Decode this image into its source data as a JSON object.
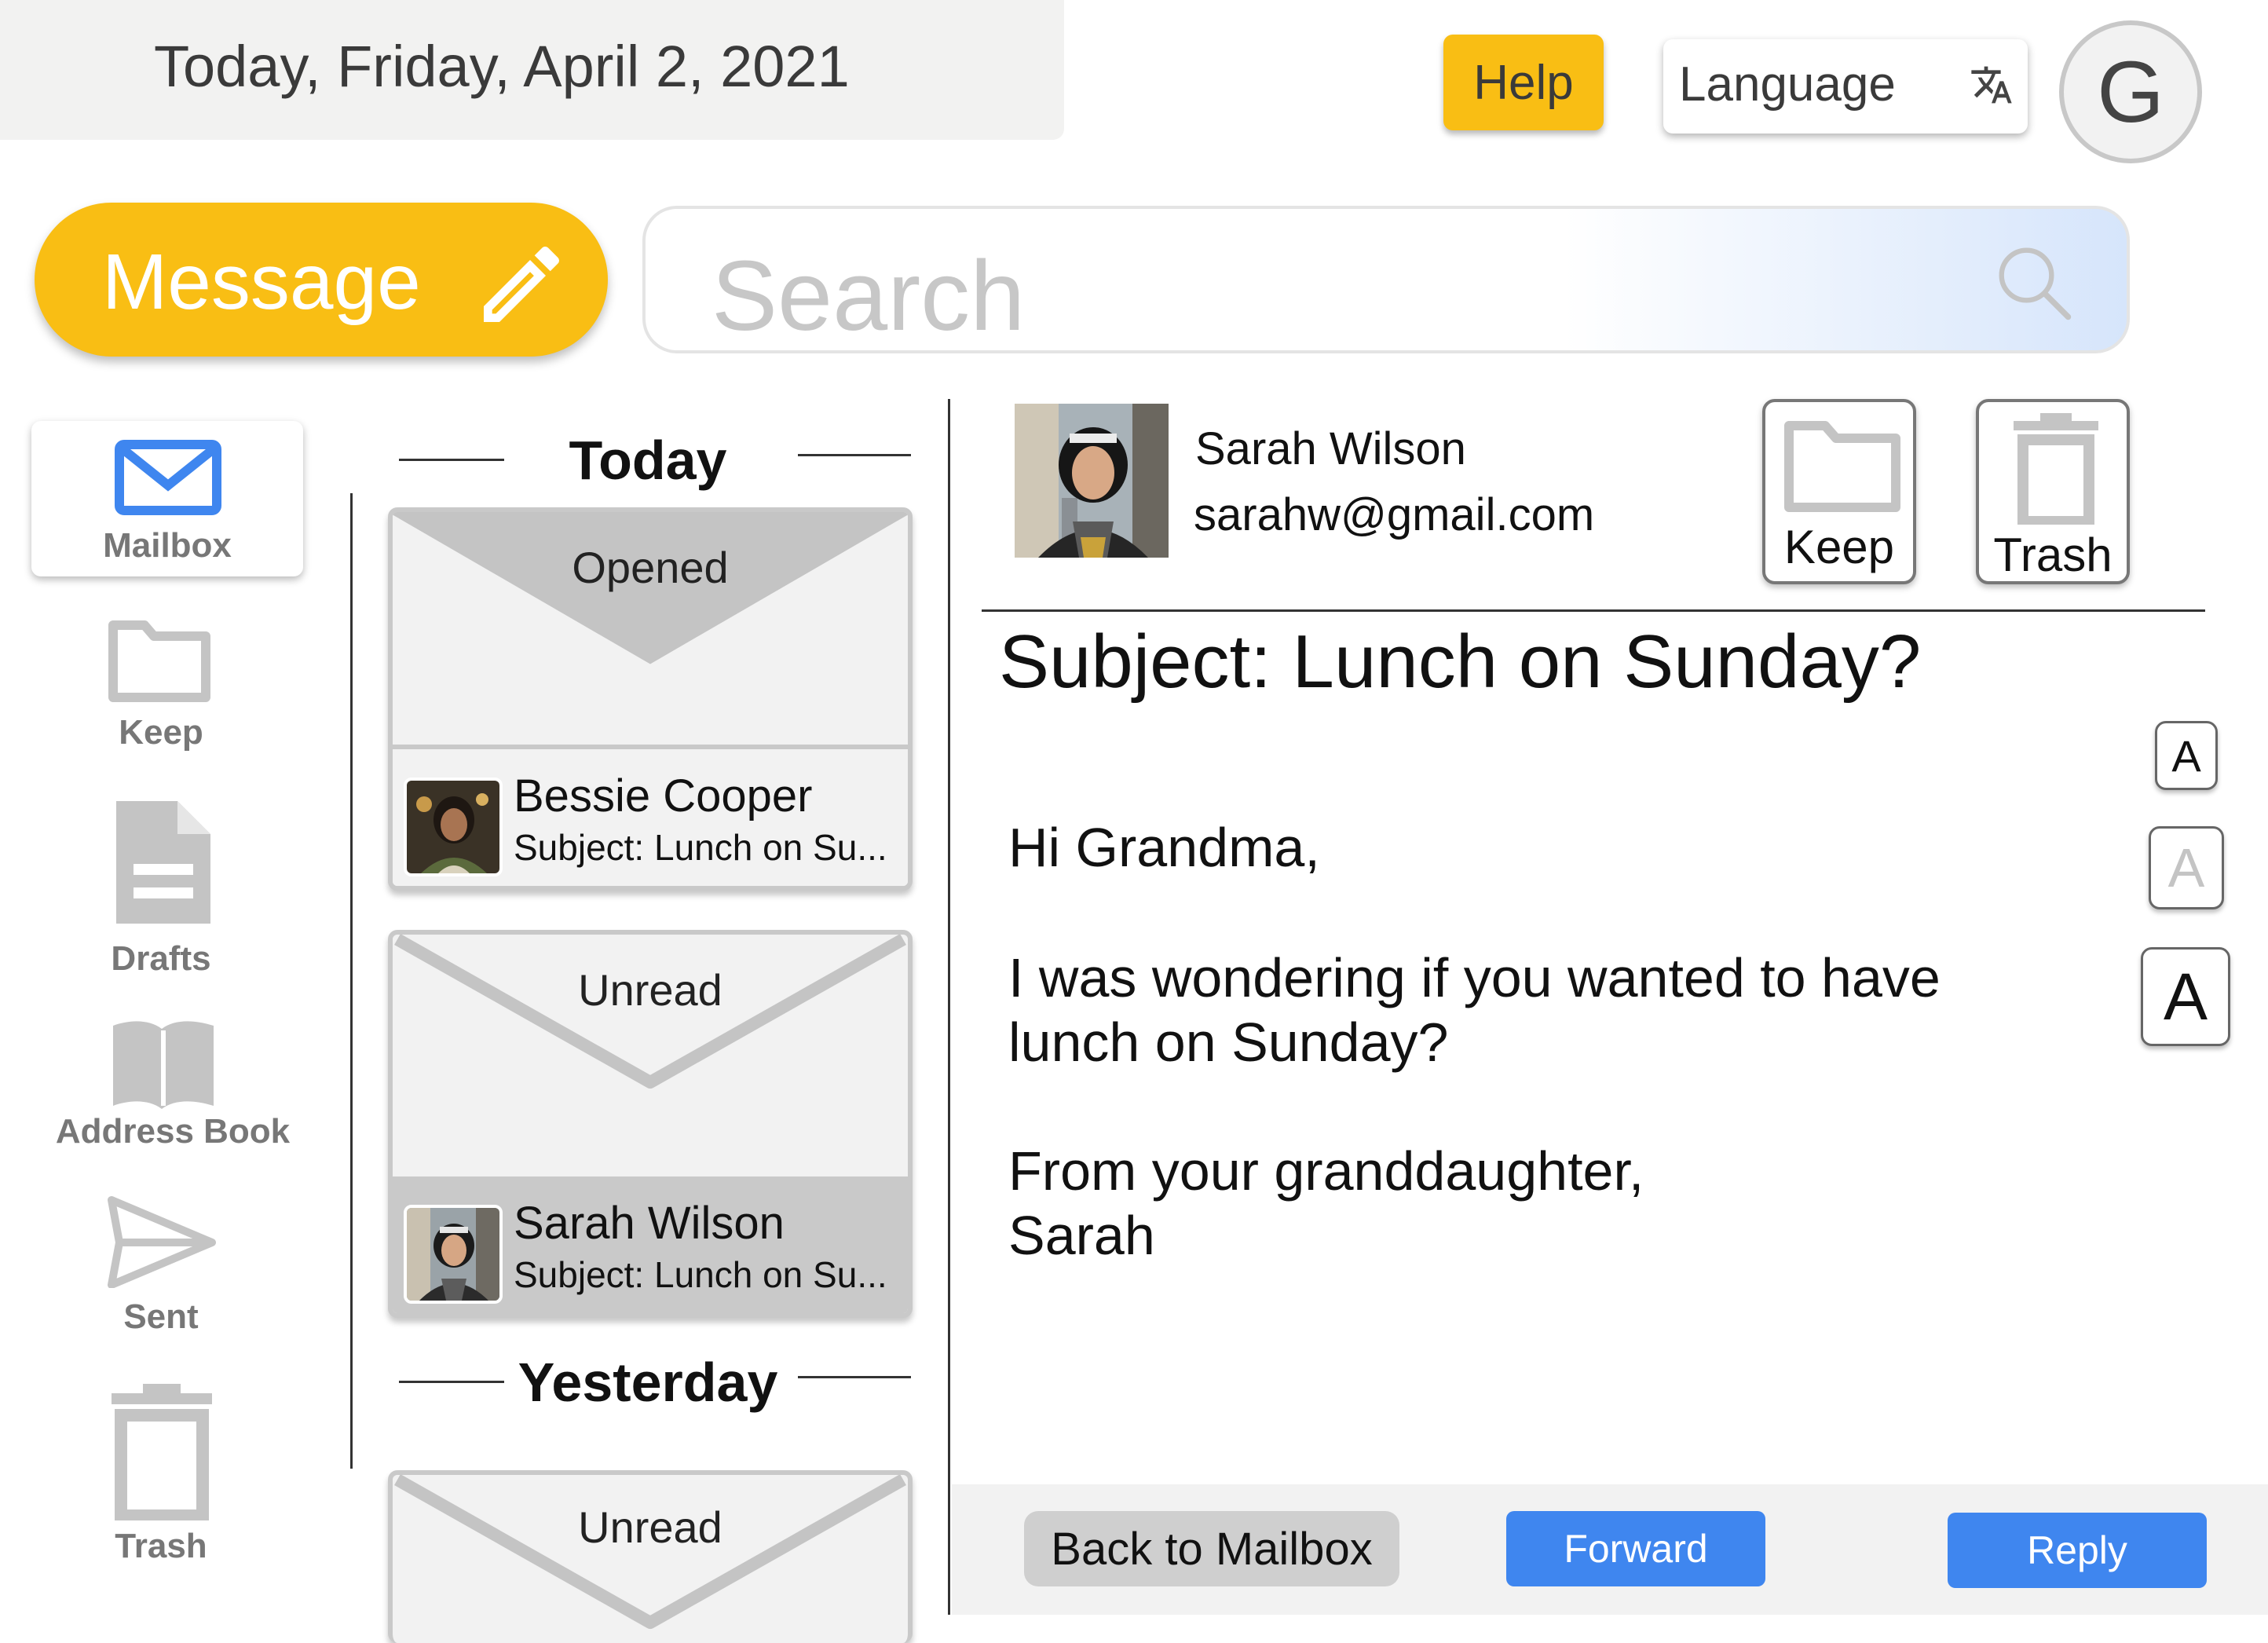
{
  "header": {
    "date_text": "Today, Friday, April 2, 2021",
    "help_label": "Help",
    "language_label": "Language",
    "language_icon": "translate-icon",
    "profile_initial": "G"
  },
  "toolbar": {
    "message_label": "Message",
    "message_icon": "pencil-icon",
    "search_placeholder": "Search",
    "search_icon": "search-icon"
  },
  "sidebar": {
    "items": [
      {
        "label": "Mailbox",
        "icon": "mail-icon",
        "active": true
      },
      {
        "label": "Keep",
        "icon": "folder-icon"
      },
      {
        "label": "Drafts",
        "icon": "document-icon"
      },
      {
        "label": "Address Book",
        "icon": "book-icon"
      },
      {
        "label": "Sent",
        "icon": "send-icon"
      },
      {
        "label": "Trash",
        "icon": "trash-icon"
      }
    ]
  },
  "mail_list": {
    "sections": [
      {
        "title": "Today",
        "messages": [
          {
            "status": "Opened",
            "sender": "Bessie Cooper",
            "subject": "Subject: Lunch on Su..."
          },
          {
            "status": "Unread",
            "sender": "Sarah Wilson",
            "subject": "Subject: Lunch on Su...",
            "selected": true
          }
        ]
      },
      {
        "title": "Yesterday",
        "messages": [
          {
            "status": "Unread"
          }
        ]
      }
    ]
  },
  "reading_pane": {
    "sender_name": "Sarah Wilson",
    "sender_email": "sarahw@gmail.com",
    "keep_label": "Keep",
    "trash_label": "Trash",
    "subject": "Subject: Lunch on Sunday?",
    "body": {
      "greeting": "Hi Grandma,",
      "line1": "I was wondering if you wanted to have",
      "line2": "lunch on Sunday?",
      "closing": "From your granddaughter,",
      "signature": "Sarah"
    },
    "font_size_controls": [
      "A",
      "A",
      "A"
    ]
  },
  "footer": {
    "back_label": "Back to Mailbox",
    "forward_label": "Forward",
    "reply_label": "Reply"
  },
  "colors": {
    "accent_yellow": "#f9be14",
    "action_blue": "#3f86ef",
    "mail_icon_blue": "#3f86ef",
    "inactive_gray": "#c9c9c9"
  }
}
